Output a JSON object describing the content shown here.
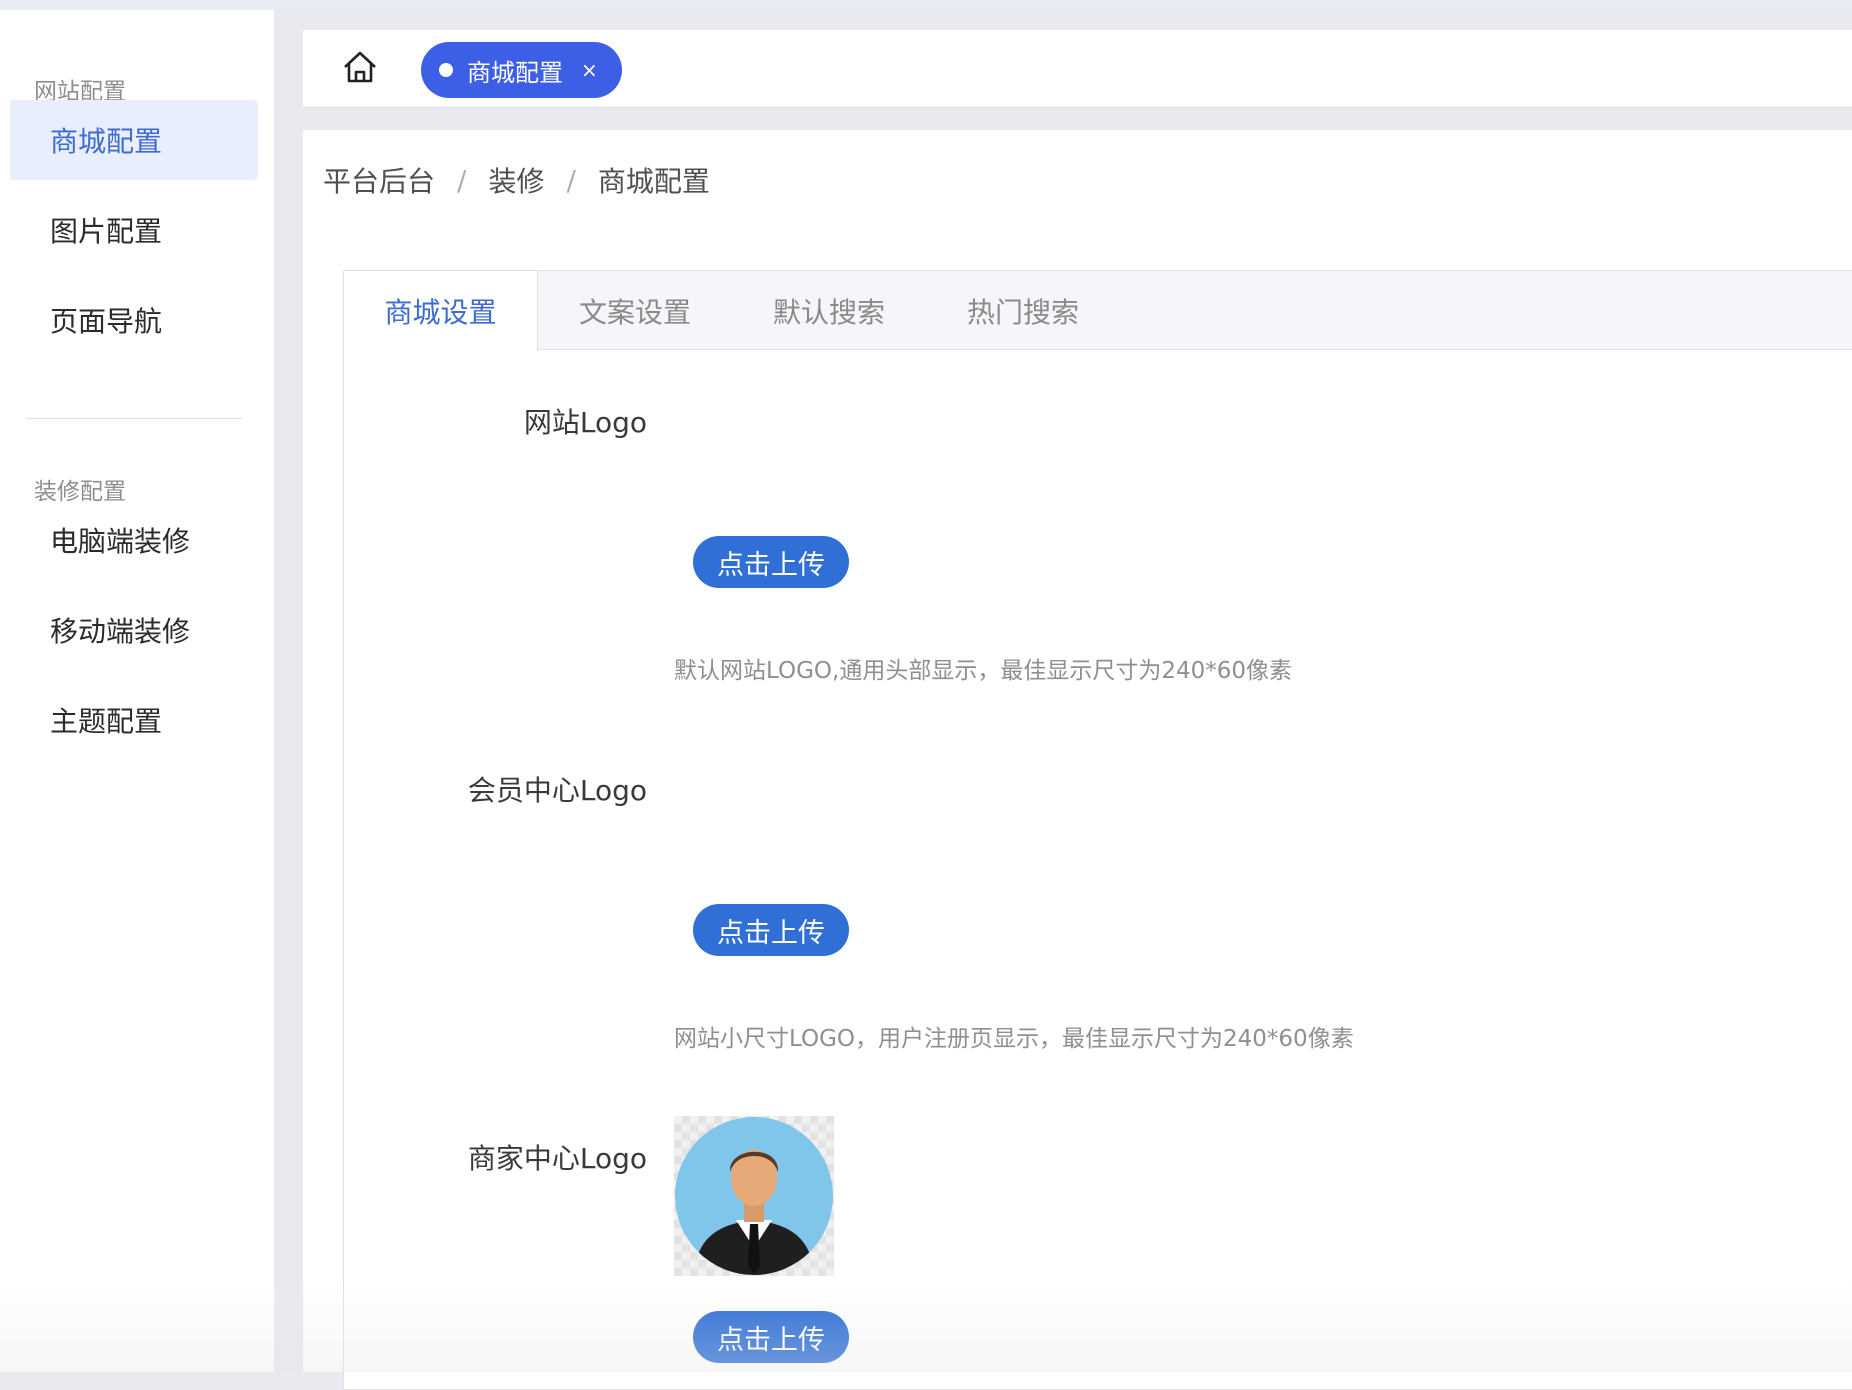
{
  "sidebar": {
    "groups": [
      {
        "title": "网站配置",
        "items": [
          "商城配置",
          "图片配置",
          "页面导航"
        ]
      },
      {
        "title": "装修配置",
        "items": [
          "电脑端装修",
          "移动端装修",
          "主题配置"
        ]
      }
    ],
    "active_item": "商城配置"
  },
  "tabbar": {
    "home_icon": "home-icon",
    "open_tab": {
      "label": "商城配置",
      "close": "×"
    }
  },
  "breadcrumb": {
    "items": [
      "平台后台",
      "装修",
      "商城配置"
    ],
    "separator": "/"
  },
  "card_tabs": {
    "items": [
      "商城设置",
      "文案设置",
      "默认搜索",
      "热门搜索"
    ],
    "active": "商城设置"
  },
  "form": {
    "fields": [
      {
        "label": "网站Logo",
        "button": "点击上传",
        "hint": "默认网站LOGO,通用头部显示，最佳显示尺寸为240*60像素"
      },
      {
        "label": "会员中心Logo",
        "button": "点击上传",
        "hint": "网站小尺寸LOGO，用户注册页显示，最佳显示尺寸为240*60像素"
      },
      {
        "label": "商家中心Logo",
        "button": "点击上传",
        "preview_icon": "businessman-avatar-icon"
      }
    ]
  },
  "colors": {
    "primary": "#2f6fd6",
    "active_text": "#3d6bd1",
    "chip": "#3d5fe5"
  }
}
